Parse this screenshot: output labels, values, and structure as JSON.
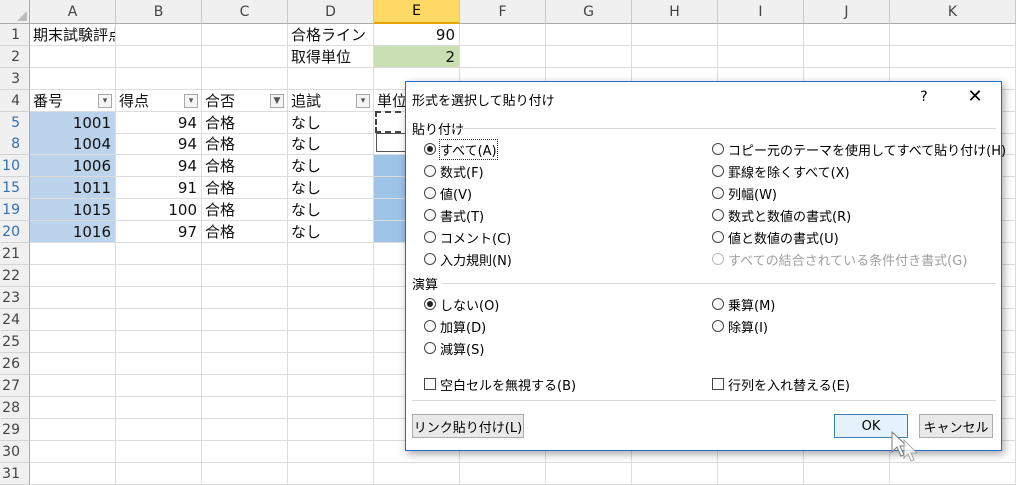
{
  "columns": [
    "A",
    "B",
    "C",
    "D",
    "E",
    "F",
    "G",
    "H",
    "I",
    "J",
    "K"
  ],
  "selected_column": "E",
  "row_headers": [
    "1",
    "2",
    "3",
    "4",
    "5",
    "8",
    "10",
    "15",
    "19",
    "20",
    "21",
    "22",
    "23",
    "24",
    "25",
    "26",
    "27",
    "28",
    "29",
    "30",
    "31"
  ],
  "cells": {
    "A1": "期末試験評点",
    "D1": "合格ライン",
    "E1": "90",
    "D2": "取得単位",
    "E2": "2",
    "A4": "番号",
    "B4": "得点",
    "C4": "合否",
    "D4": "追試",
    "E4": "単位"
  },
  "table_rows": [
    {
      "num": "1001",
      "score": "94",
      "pass": "合格",
      "retest": "なし"
    },
    {
      "num": "1004",
      "score": "94",
      "pass": "合格",
      "retest": "なし"
    },
    {
      "num": "1006",
      "score": "94",
      "pass": "合格",
      "retest": "なし"
    },
    {
      "num": "1011",
      "score": "91",
      "pass": "合格",
      "retest": "なし"
    },
    {
      "num": "1015",
      "score": "100",
      "pass": "合格",
      "retest": "なし"
    },
    {
      "num": "1016",
      "score": "97",
      "pass": "合格",
      "retest": "なし"
    }
  ],
  "colors": {
    "selection": "#bcd3ec",
    "green_cell": "#c8e0b4",
    "dialog_border": "#1e6ec8"
  },
  "dialog": {
    "title": "形式を選択して貼り付け",
    "help": "?",
    "close": "✕",
    "paste_group": "貼り付け",
    "paste_left": [
      {
        "label": "すべて(A)",
        "checked": true,
        "disabled": false
      },
      {
        "label": "数式(F)",
        "checked": false,
        "disabled": false
      },
      {
        "label": "値(V)",
        "checked": false,
        "disabled": false
      },
      {
        "label": "書式(T)",
        "checked": false,
        "disabled": false
      },
      {
        "label": "コメント(C)",
        "checked": false,
        "disabled": false
      },
      {
        "label": "入力規則(N)",
        "checked": false,
        "disabled": false
      }
    ],
    "paste_right": [
      {
        "label": "コピー元のテーマを使用してすべて貼り付け(H)",
        "checked": false,
        "disabled": false
      },
      {
        "label": "罫線を除くすべて(X)",
        "checked": false,
        "disabled": false
      },
      {
        "label": "列幅(W)",
        "checked": false,
        "disabled": false
      },
      {
        "label": "数式と数値の書式(R)",
        "checked": false,
        "disabled": false
      },
      {
        "label": "値と数値の書式(U)",
        "checked": false,
        "disabled": false
      },
      {
        "label": "すべての結合されている条件付き書式(G)",
        "checked": false,
        "disabled": true
      }
    ],
    "op_group": "演算",
    "op_left": [
      {
        "label": "しない(O)",
        "checked": true
      },
      {
        "label": "加算(D)",
        "checked": false
      },
      {
        "label": "減算(S)",
        "checked": false
      }
    ],
    "op_right": [
      {
        "label": "乗算(M)",
        "checked": false
      },
      {
        "label": "除算(I)",
        "checked": false
      }
    ],
    "skip_blanks": "空白セルを無視する(B)",
    "transpose": "行列を入れ替える(E)",
    "paste_link": "リンク貼り付け(L)",
    "ok": "OK",
    "cancel": "キャンセル"
  }
}
